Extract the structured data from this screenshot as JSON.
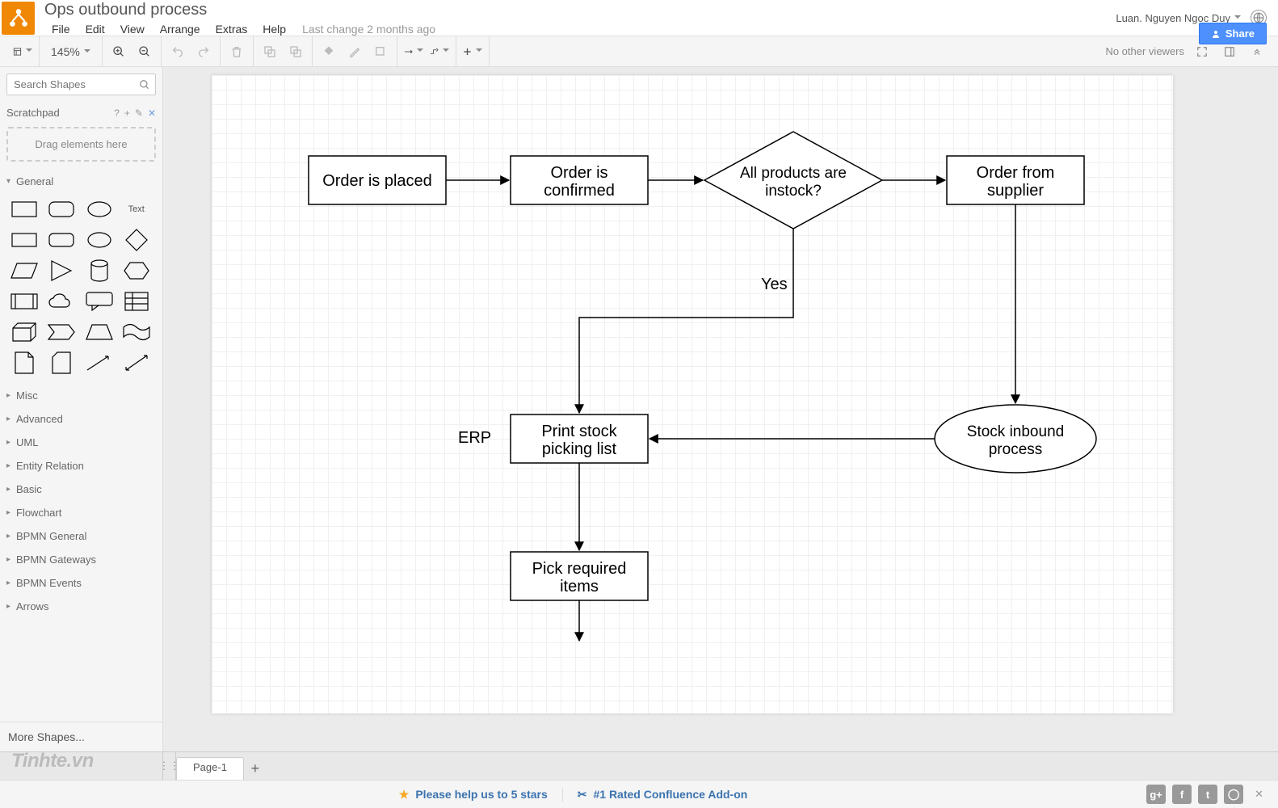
{
  "header": {
    "doc_title": "Ops outbound process",
    "menu": [
      "File",
      "Edit",
      "View",
      "Arrange",
      "Extras",
      "Help"
    ],
    "last_change": "Last change 2 months ago",
    "user_name": "Luan. Nguyen Ngoc Duy",
    "share_label": "Share"
  },
  "toolbar": {
    "zoom": "145%",
    "no_viewers": "No other viewers"
  },
  "sidebar": {
    "search_placeholder": "Search Shapes",
    "scratchpad_title": "Scratchpad",
    "scratchpad_drop": "Drag elements here",
    "text_shape": "Text",
    "categories": {
      "general": "General",
      "misc": "Misc",
      "advanced": "Advanced",
      "uml": "UML",
      "entity": "Entity Relation",
      "basic": "Basic",
      "flowchart": "Flowchart",
      "bpmn_general": "BPMN General",
      "bpmn_gateways": "BPMN Gateways",
      "bpmn_events": "BPMN Events",
      "arrows": "Arrows"
    },
    "more_shapes": "More Shapes..."
  },
  "diagram": {
    "nodes": {
      "order_placed": "Order is placed",
      "order_confirmed": "Order is confirmed",
      "instock": "All products are instock?",
      "order_supplier": "Order from supplier",
      "yes_label": "Yes",
      "erp_label": "ERP",
      "print_picking": "Print stock picking list",
      "stock_inbound": "Stock inbound process",
      "pick_items": "Pick required items"
    }
  },
  "pages": {
    "page1": "Page-1"
  },
  "footer": {
    "rate": "Please help us to 5 stars",
    "rated": "#1 Rated Confluence Add-on"
  },
  "watermark": "Tinhte.vn",
  "chart_data": {
    "type": "flowchart",
    "nodes": [
      {
        "id": "order_placed",
        "shape": "process",
        "label": "Order is placed"
      },
      {
        "id": "order_confirmed",
        "shape": "process",
        "label": "Order is confirmed"
      },
      {
        "id": "instock",
        "shape": "decision",
        "label": "All products are instock?"
      },
      {
        "id": "order_supplier",
        "shape": "process",
        "label": "Order from supplier"
      },
      {
        "id": "print_picking",
        "shape": "process",
        "label": "Print stock picking list",
        "annotation": "ERP"
      },
      {
        "id": "stock_inbound",
        "shape": "terminator",
        "label": "Stock inbound process"
      },
      {
        "id": "pick_items",
        "shape": "process",
        "label": "Pick required items"
      }
    ],
    "edges": [
      {
        "from": "order_placed",
        "to": "order_confirmed"
      },
      {
        "from": "order_confirmed",
        "to": "instock"
      },
      {
        "from": "instock",
        "to": "order_supplier",
        "label": ""
      },
      {
        "from": "instock",
        "to": "print_picking",
        "label": "Yes"
      },
      {
        "from": "order_supplier",
        "to": "stock_inbound"
      },
      {
        "from": "stock_inbound",
        "to": "print_picking"
      },
      {
        "from": "print_picking",
        "to": "pick_items"
      }
    ]
  }
}
